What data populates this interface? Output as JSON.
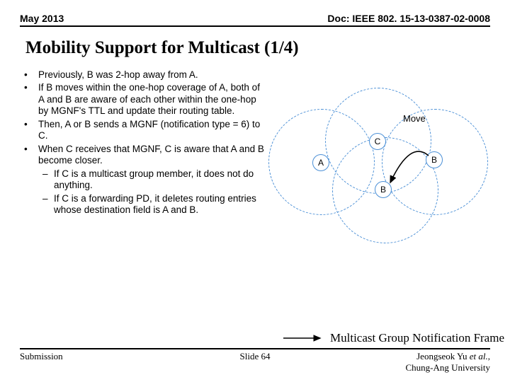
{
  "header": {
    "date": "May 2013",
    "doc": "Doc: IEEE 802. 15-13-0387-02-0008"
  },
  "title": "Mobility Support for Multicast (1/4)",
  "bullets": {
    "b1": "Previously, B was 2-hop away from A.",
    "b2": "If B moves within the one-hop coverage of A, both of A and B are aware of each other within the one-hop by MGNF's TTL and update their routing table.",
    "b3": "Then, A or B sends a MGNF (notification type = 6) to C.",
    "b4": "When C receives that MGNF, C is aware that A and B become closer.",
    "b4a": "If C is a multicast group member, it does not do anything.",
    "b4b": "If C is a forwarding PD, it deletes routing entries whose destination field is A and B."
  },
  "diagram": {
    "move": "Move",
    "A": "A",
    "B": "B",
    "B2": "B",
    "C": "C"
  },
  "caption": "Multicast Group Notification Frame",
  "footer": {
    "left": "Submission",
    "center": "Slide 64",
    "right1": "Jeongseok Yu ",
    "right1_ital": "et al.",
    "right1_end": ", ",
    "right2": "Chung-Ang University"
  }
}
